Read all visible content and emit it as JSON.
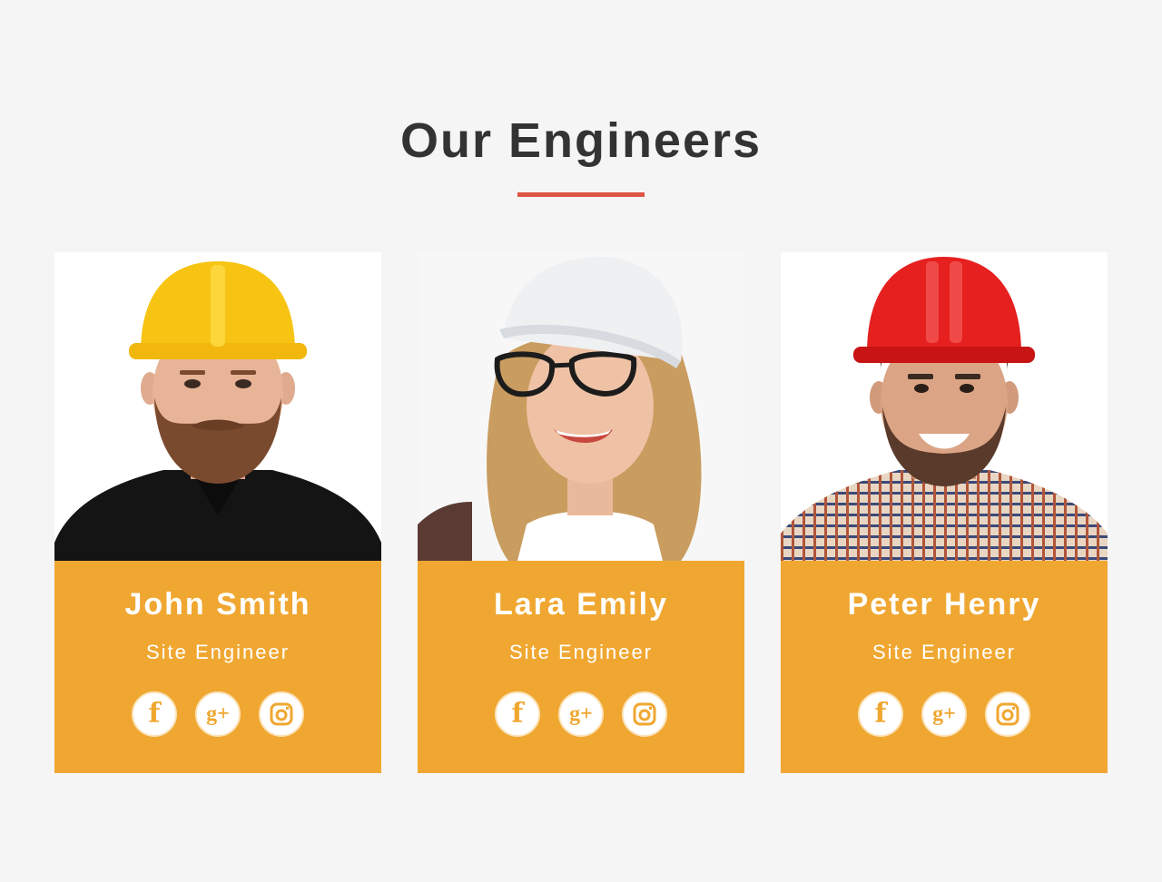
{
  "section": {
    "title": "Our Engineers"
  },
  "colors": {
    "background": "#f5f5f5",
    "title": "#333333",
    "accent_underline": "#dd5444",
    "card_info_bg": "#f0a731",
    "card_text": "#ffffff"
  },
  "engineers": [
    {
      "name": "John Smith",
      "role": "Site Engineer",
      "photo": {
        "helmet_color": "#f7c414",
        "shirt": "black",
        "hair": "#8b5a3c"
      },
      "socials": [
        {
          "icon": "facebook-icon",
          "glyph": "f"
        },
        {
          "icon": "google-plus-icon",
          "glyph": "g+"
        },
        {
          "icon": "instagram-icon",
          "glyph": ""
        }
      ]
    },
    {
      "name": "Lara Emily",
      "role": "Site Engineer",
      "photo": {
        "helmet_color": "#eef0f2",
        "shirt": "white",
        "hair": "#c99c5f"
      },
      "socials": [
        {
          "icon": "facebook-icon",
          "glyph": "f"
        },
        {
          "icon": "google-plus-icon",
          "glyph": "g+"
        },
        {
          "icon": "instagram-icon",
          "glyph": ""
        }
      ]
    },
    {
      "name": "Peter Henry",
      "role": "Site Engineer",
      "photo": {
        "helmet_color": "#e5201f",
        "shirt": "plaid",
        "hair": "#3a2a22"
      },
      "socials": [
        {
          "icon": "facebook-icon",
          "glyph": "f"
        },
        {
          "icon": "google-plus-icon",
          "glyph": "g+"
        },
        {
          "icon": "instagram-icon",
          "glyph": ""
        }
      ]
    }
  ]
}
